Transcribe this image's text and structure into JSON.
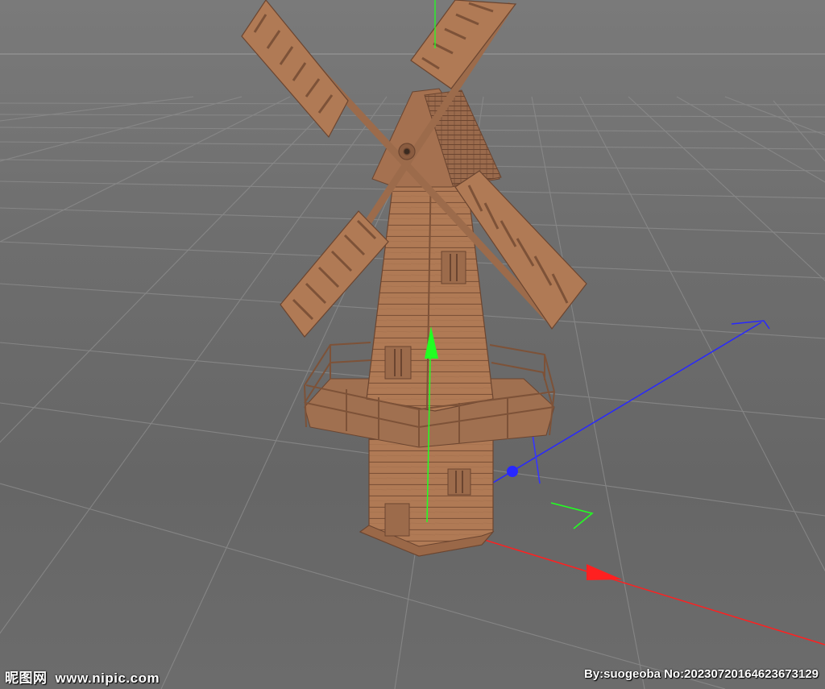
{
  "viewport": {
    "type": "3d-modeling-viewport",
    "background_color": "#6f6f6f",
    "grid_color": "#8c8c8c"
  },
  "model": {
    "name": "windmill",
    "wood_color": "#b07a55",
    "wood_dark": "#7d5238",
    "sails": 4
  },
  "axes": {
    "x_color": "#ff2020",
    "y_color": "#22ff22",
    "z_color": "#2828ff"
  },
  "watermark": {
    "site_name": "昵图网",
    "site_url": "www.nipic.com",
    "credit": "By:suogeoba No:20230720164623673129"
  }
}
